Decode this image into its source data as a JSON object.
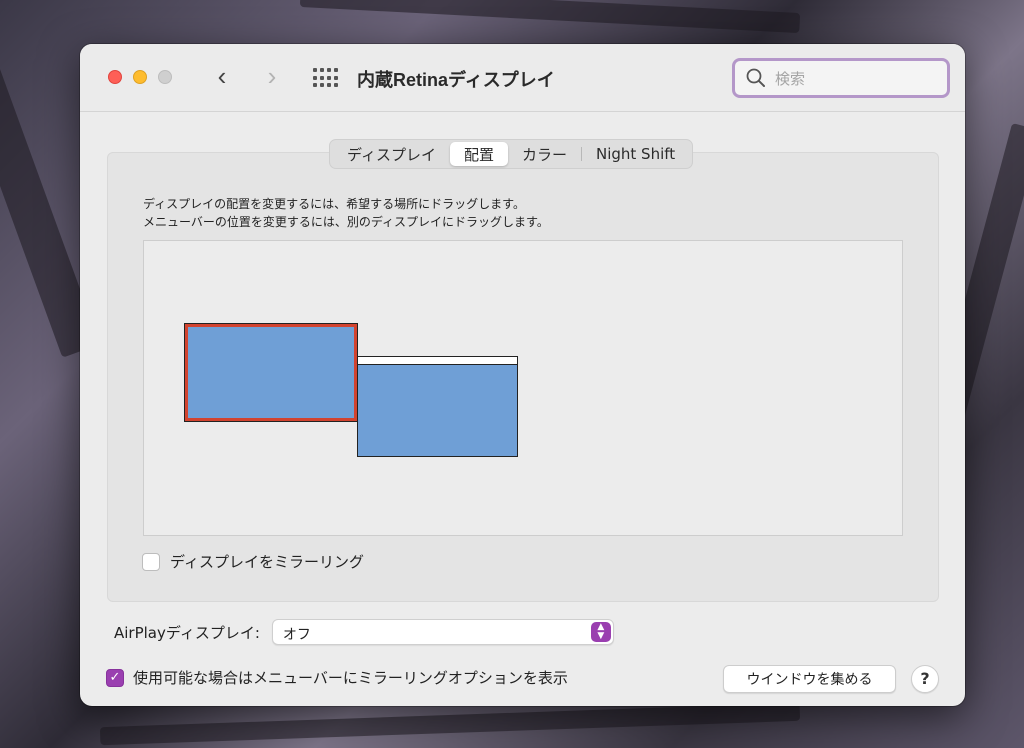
{
  "window": {
    "title": "内蔵Retinaディスプレイ",
    "search_placeholder": "検索"
  },
  "navigation": {
    "back_icon": "chevron-left-icon",
    "forward_icon": "chevron-right-icon",
    "show_all_icon": "grid-icon"
  },
  "tabs": [
    {
      "label": "ディスプレイ",
      "active": false
    },
    {
      "label": "配置",
      "active": true
    },
    {
      "label": "カラー",
      "active": false
    },
    {
      "label": "Night Shift",
      "active": false
    }
  ],
  "arrangement": {
    "instruction_line1": "ディスプレイの配置を変更するには、希望する場所にドラッグします。",
    "instruction_line2": "メニューバーの位置を変更するには、別のディスプレイにドラッグします。",
    "mirror_label": "ディスプレイをミラーリング",
    "mirror_checked": false
  },
  "airplay": {
    "label": "AirPlayディスプレイ:",
    "selected": "オフ"
  },
  "footer": {
    "show_mirroring_label": "使用可能な場合はメニューバーにミラーリングオプションを表示",
    "show_mirroring_checked": true,
    "gather_button": "ウインドウを集める",
    "help_button": "?"
  },
  "colors": {
    "accent": "#9a3fb0",
    "display_fill": "#6f9fd6",
    "selected_display_border": "#d2432f",
    "search_focus_ring": "#b497c9"
  }
}
